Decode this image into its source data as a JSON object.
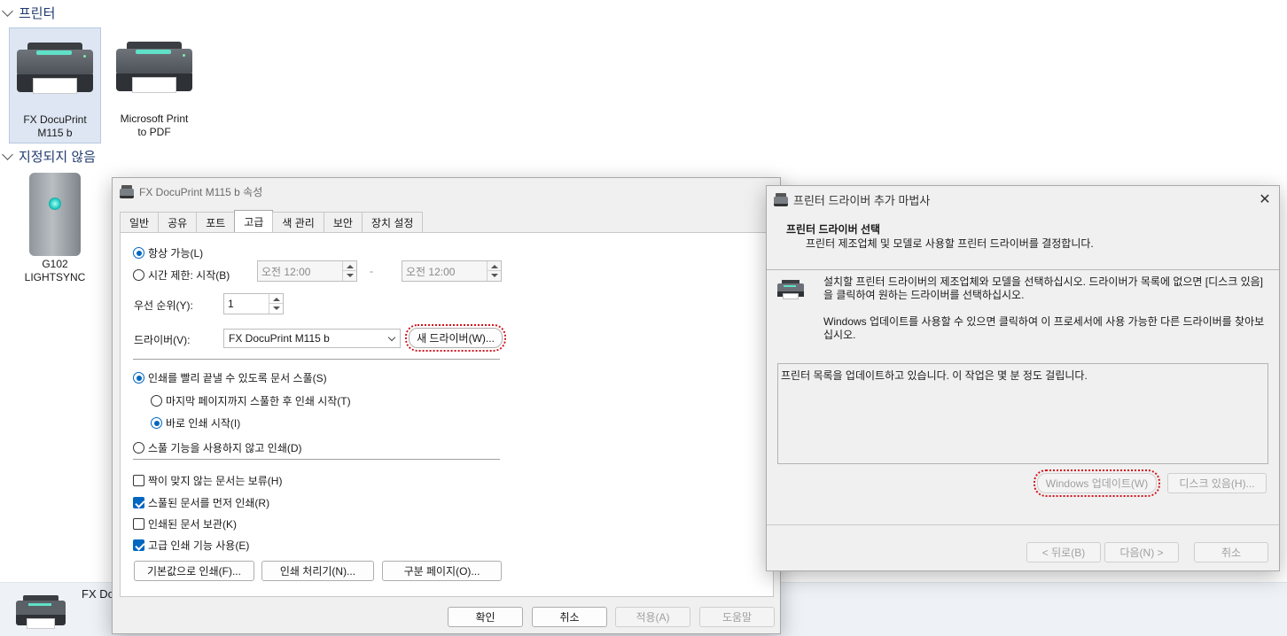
{
  "explorer": {
    "group_printers": "프린터",
    "group_unspecified": "지정되지 않음",
    "devices": [
      {
        "line1": "FX DocuPrint",
        "line2": "M115 b"
      },
      {
        "line1": "Microsoft Print",
        "line2": "to PDF"
      }
    ],
    "unspecified_devices": [
      {
        "line1": "G102",
        "line2": "LIGHTSYNC"
      }
    ],
    "status_label": "FX Doc"
  },
  "properties_dialog": {
    "title": "FX DocuPrint M115 b 속성",
    "tabs": [
      "일반",
      "공유",
      "포트",
      "고급",
      "색 관리",
      "보안",
      "장치 설정"
    ],
    "active_tab": "고급",
    "always_available": "항상 가능(L)",
    "time_limited": "시간 제한: 시작(B)",
    "time_from": "오전 12:00",
    "time_dash": "-",
    "time_to": "오전 12:00",
    "priority_label": "우선 순위(Y):",
    "priority_value": "1",
    "driver_label": "드라이버(V):",
    "driver_value": "FX DocuPrint M115 b",
    "new_driver_button": "새 드라이버(W)...",
    "spool_option": "인쇄를 빨리 끝낼 수 있도록 문서 스풀(S)",
    "spool_after_last_page": "마지막 페이지까지 스풀한 후 인쇄 시작(T)",
    "spool_start_immediately": "바로 인쇄 시작(I)",
    "print_direct": "스풀 기능을 사용하지 않고 인쇄(D)",
    "checks": [
      {
        "label": "짝이 맞지 않는 문서는 보류(H)",
        "checked": false
      },
      {
        "label": "스풀된 문서를 먼저 인쇄(R)",
        "checked": true
      },
      {
        "label": "인쇄된 문서 보관(K)",
        "checked": false
      },
      {
        "label": "고급 인쇄 기능 사용(E)",
        "checked": true
      }
    ],
    "buttons": {
      "defaults": "기본값으로 인쇄(F)...",
      "processor": "인쇄 처리기(N)...",
      "separator": "구분 페이지(O)..."
    },
    "footer": {
      "ok": "확인",
      "cancel": "취소",
      "apply": "적용(A)",
      "help": "도움말"
    }
  },
  "wizard_dialog": {
    "title": "프린터 드라이버 추가 마법사",
    "heading": "프린터 드라이버 선택",
    "subheading": "프린터 제조업체 및 모델로 사용할 프린터 드라이버를 결정합니다.",
    "instruction_1": "설치할 프린터 드라이버의 제조업체와 모델을 선택하십시오. 드라이버가 목록에 없으면 [디스크 있음]을 클릭하여 원하는 드라이버를 선택하십시오.",
    "instruction_2": "Windows 업데이트를 사용할 수 있으면 클릭하여 이 프로세서에 사용 가능한 다른 드라이버를 찾아보십시오.",
    "list_message": "프린터 목록을 업데이트하고 있습니다. 이 작업은 몇 분 정도 걸립니다.",
    "windows_update_button": "Windows 업데이트(W)",
    "have_disk_button": "디스크 있음(H)...",
    "back_button": "< 뒤로(B)",
    "next_button": "다음(N) >",
    "cancel_button": "취소"
  },
  "colors": {
    "accent": "#0067c0",
    "highlight_outline": "#d0141e",
    "dialog_bg": "#f0f0f0",
    "selection_bg": "#dde6f2"
  }
}
